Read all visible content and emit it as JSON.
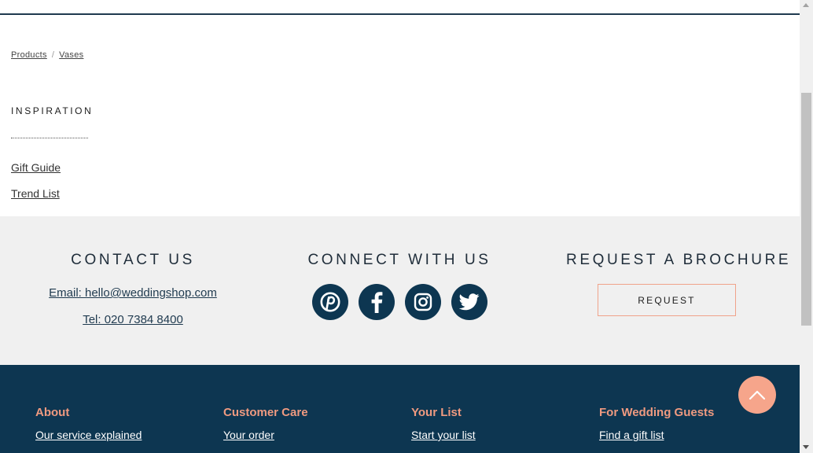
{
  "breadcrumb": {
    "items": [
      "Products",
      "Vases"
    ],
    "separator": "/"
  },
  "inspiration": {
    "title": "INSPIRATION",
    "links": [
      "Gift Guide",
      "Trend List"
    ]
  },
  "contact": {
    "title": "CONTACT US",
    "email": "Email: hello@weddingshop.com",
    "tel": "Tel: 020 7384 8400"
  },
  "connect": {
    "title": "CONNECT WITH US",
    "icons": [
      "pinterest-icon",
      "facebook-icon",
      "instagram-icon",
      "twitter-icon"
    ]
  },
  "brochure": {
    "title": "REQUEST A BROCHURE",
    "button_label": "REQUEST"
  },
  "footer": {
    "columns": [
      {
        "heading": "About",
        "links": [
          "Our service explained"
        ]
      },
      {
        "heading": "Customer Care",
        "links": [
          "Your order"
        ]
      },
      {
        "heading": "Your List",
        "links": [
          "Start your list"
        ]
      },
      {
        "heading": "For Wedding Guests",
        "links": [
          "Find a gift list"
        ]
      }
    ]
  },
  "colors": {
    "navy": "#0d3651",
    "accent_peach": "#f6a58b",
    "band_grey": "#f0f0f0"
  }
}
